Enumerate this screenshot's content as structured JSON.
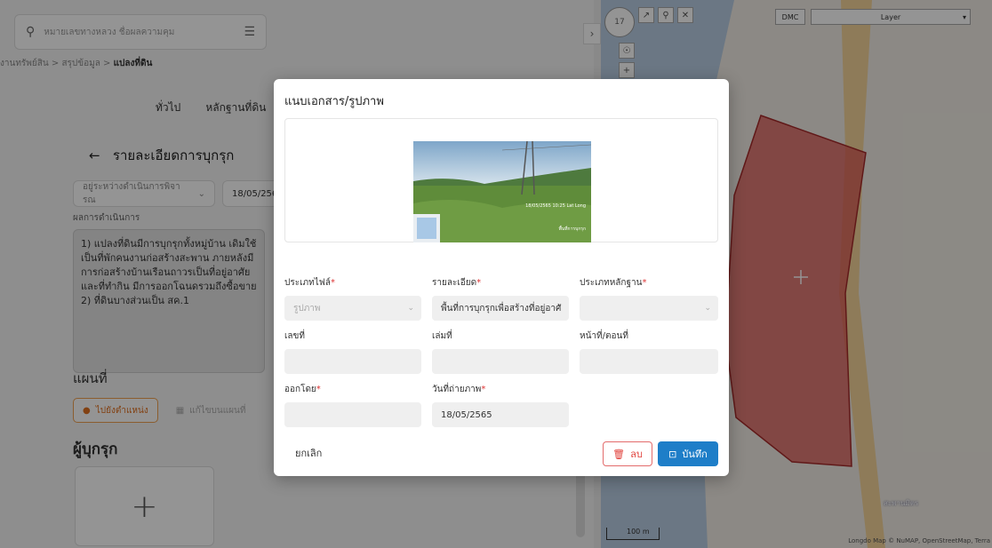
{
  "left_panel": {
    "search_placeholder": "หมายเลขทางหลวง ชื่อผลความคุม",
    "breadcrumb": [
      "งานทรัพย์สิน",
      "สรุปข้อมูล",
      "แปลงที่ดิน"
    ],
    "tabs": [
      "ทั่วไป",
      "หลักฐานที่ดิน"
    ],
    "section_title": "รายละเอียดการบุกรุก",
    "status_select": "อยู่ระหว่างดำเนินการพิจารณ",
    "date_value": "18/05/256",
    "result_label": "ผลการดำเนินการ",
    "result_text": "1) แปลงที่ดินมีการบุกรุกทั้งหมู่บ้าน เดิมใช้เป็นที่พักคนงานก่อสร้างสะพาน ภายหลังมีการก่อสร้างบ้านเรือนถาวรเป็นที่อยู่อาศัยและที่ทำกิน มีการออกโฉนดรวมถึงซื้อขาย\n2) ที่ดินบางส่วนเป็น สค.1",
    "map_title": "แผนที่",
    "loc_button": "ไปยังตำแหน่ง",
    "loc_button2": "แก้ไขบนแผนที่",
    "invader_title": "ผู้บุกรุก",
    "add_symbol": "+"
  },
  "map": {
    "dmc_label": "DMC",
    "layer_label": "Layer",
    "scale_label": "100 m",
    "attribution": "Longdo Map © NuMAP, OpenStreetMap, Terra",
    "place_label": "สะพานมิตร",
    "polygon_color": "#d9534f"
  },
  "modal": {
    "title": "แนบเอกสาร/รูปภาพ",
    "photo_caption": "18/05/2565 10:25 Lat Long",
    "photo_caption2": "พื้นที่การบุกรุก",
    "fields": {
      "file_type": {
        "label": "ประเภทไฟล์",
        "value": "รูปภาพ"
      },
      "detail": {
        "label": "รายละเอียด",
        "value": "พื้นที่การบุกรุกเพื่อสร้างที่อยู่อาศั"
      },
      "evidence_type": {
        "label": "ประเภทหลักฐาน",
        "value": ""
      },
      "number": {
        "label": "เลขที่",
        "value": ""
      },
      "book_no": {
        "label": "เล่มที่",
        "value": ""
      },
      "page_no": {
        "label": "หน้าที่/ตอนที่",
        "value": ""
      },
      "issued_by": {
        "label": "ออกโดย",
        "value": ""
      },
      "photo_date": {
        "label": "วันที่ถ่ายภาพ",
        "value": "18/05/2565"
      }
    },
    "required_mark": "*",
    "cancel_label": "ยกเลิก",
    "delete_label": "ลบ",
    "save_label": "บันทึก",
    "accent_color": "#1e7ec8",
    "danger_color": "#e0403a"
  }
}
